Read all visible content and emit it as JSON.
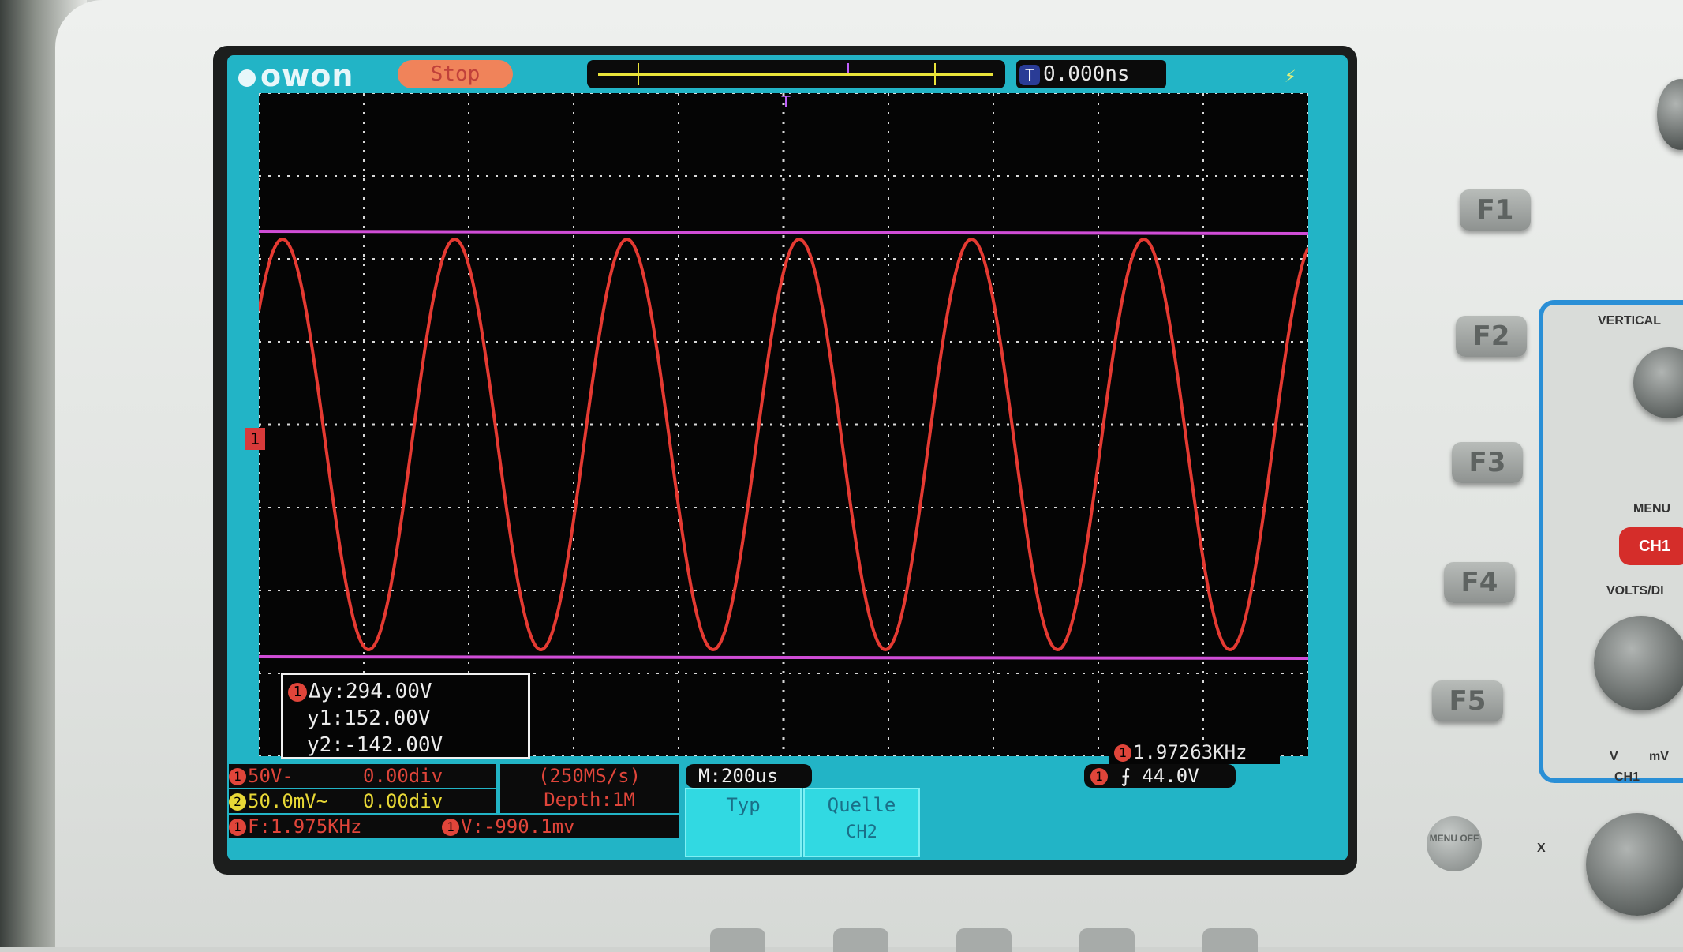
{
  "device": {
    "brand": "owon",
    "run_state": "Stop",
    "trigger_delay": "0.000ns",
    "trigger_delay_badge": "T"
  },
  "waveform": {
    "channel_marker": "1",
    "color": "#e53a32",
    "cursor_color": "#d04dd6",
    "cycles_visible": 6
  },
  "cursor_readout": {
    "badge": "1",
    "dy": "Δy:294.00V",
    "y1": "y1:152.00V",
    "y2": "y2:-142.00V"
  },
  "frequency_counter": {
    "badge": "1",
    "value": "1.97263KHz"
  },
  "channels": {
    "ch1": {
      "badge": "1",
      "scale": "50V-",
      "offset": "0.00div"
    },
    "ch2": {
      "badge": "2",
      "scale": "50.0mV~",
      "offset": "0.00div"
    }
  },
  "acquisition": {
    "sample_rate": "(250MS/s)",
    "depth": "Depth:1M"
  },
  "measurements": {
    "freq_badge": "1",
    "freq": "F:1.975KHz",
    "v_badge": "1",
    "v": "V:-990.1mv"
  },
  "timebase": "M:200us",
  "trigger": {
    "badge": "1",
    "level": "44.0V"
  },
  "menu": {
    "typ_label": "Typ",
    "typ_value": "",
    "quelle_label": "Quelle",
    "quelle_value": "CH2"
  },
  "front_panel": {
    "f_buttons": [
      "F1",
      "F2",
      "F3",
      "F4",
      "F5"
    ],
    "vertical_label": "VERTICAL",
    "menu_label": "MENU",
    "ch1_button": "CH1",
    "volts_div_label": "VOLTS/DI",
    "ch1_label": "CH1",
    "menu_off": "MENU OFF",
    "x_label": "X",
    "v_unit": "V",
    "mv_unit": "mV"
  }
}
